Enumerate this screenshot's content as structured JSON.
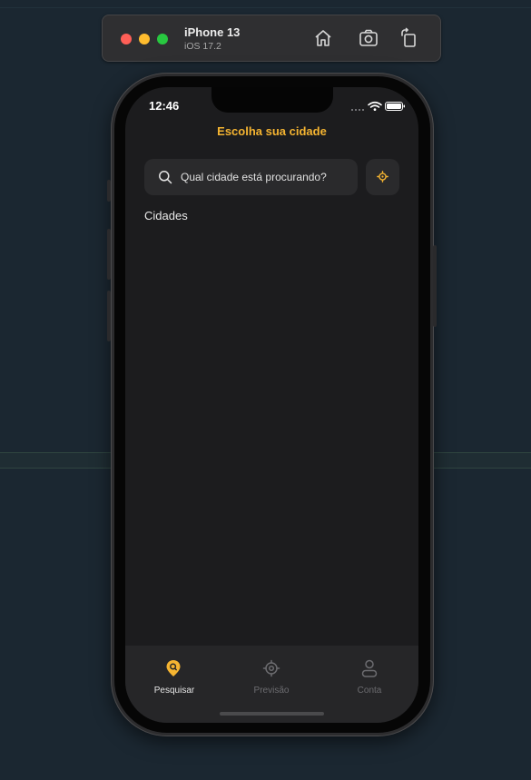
{
  "simulator": {
    "device_name": "iPhone 13",
    "os_version": "iOS 17.2",
    "toolbar_icons": [
      "home-icon",
      "screenshot-icon",
      "rotate-icon"
    ]
  },
  "status_bar": {
    "time": "12:46"
  },
  "screen": {
    "title": "Escolha sua cidade",
    "search": {
      "placeholder": "Qual cidade está procurando?",
      "value": ""
    },
    "section_title": "Cidades"
  },
  "tabbar": {
    "items": [
      {
        "label": "Pesquisar",
        "icon": "search-location-icon",
        "active": true
      },
      {
        "label": "Previsão",
        "icon": "target-icon",
        "active": false
      },
      {
        "label": "Conta",
        "icon": "user-icon",
        "active": false
      }
    ]
  },
  "colors": {
    "accent": "#f5b431",
    "background": "#1c1c1e",
    "surface": "#2a2a2c",
    "tabbar": "#262628"
  }
}
